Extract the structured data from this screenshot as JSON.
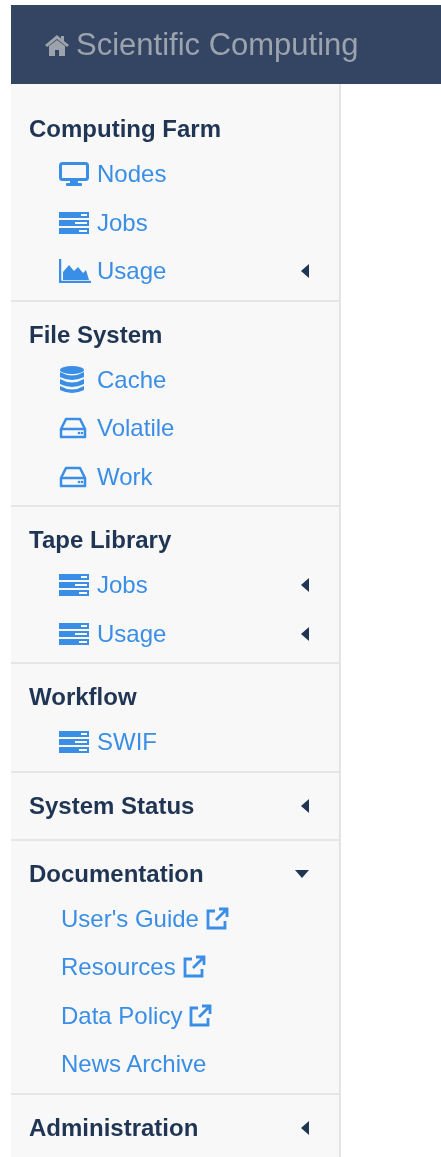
{
  "header": {
    "title": "Scientific Computing"
  },
  "sections": [
    {
      "title": "Computing Farm",
      "items": [
        {
          "label": "Nodes",
          "kind": "desktop"
        },
        {
          "label": "Jobs",
          "kind": "server"
        },
        {
          "label": "Usage",
          "kind": "chart",
          "expanded": false
        }
      ]
    },
    {
      "title": "File System",
      "items": [
        {
          "label": "Cache",
          "kind": "database"
        },
        {
          "label": "Volatile",
          "kind": "drive"
        },
        {
          "label": "Work",
          "kind": "drive"
        }
      ]
    },
    {
      "title": "Tape Library",
      "items": [
        {
          "label": "Jobs",
          "kind": "server",
          "expanded": false
        },
        {
          "label": "Usage",
          "kind": "server",
          "expanded": false
        }
      ]
    },
    {
      "title": "Workflow",
      "items": [
        {
          "label": "SWIF",
          "kind": "server"
        }
      ]
    },
    {
      "title": "System Status",
      "expanded": false
    },
    {
      "title": "Documentation",
      "expanded": true,
      "items": [
        {
          "label": "User's Guide",
          "kind": "external"
        },
        {
          "label": "Resources",
          "kind": "external"
        },
        {
          "label": "Data Policy",
          "kind": "external"
        },
        {
          "label": "News Archive",
          "kind": "plain"
        }
      ]
    },
    {
      "title": "Administration",
      "expanded": false
    }
  ]
}
